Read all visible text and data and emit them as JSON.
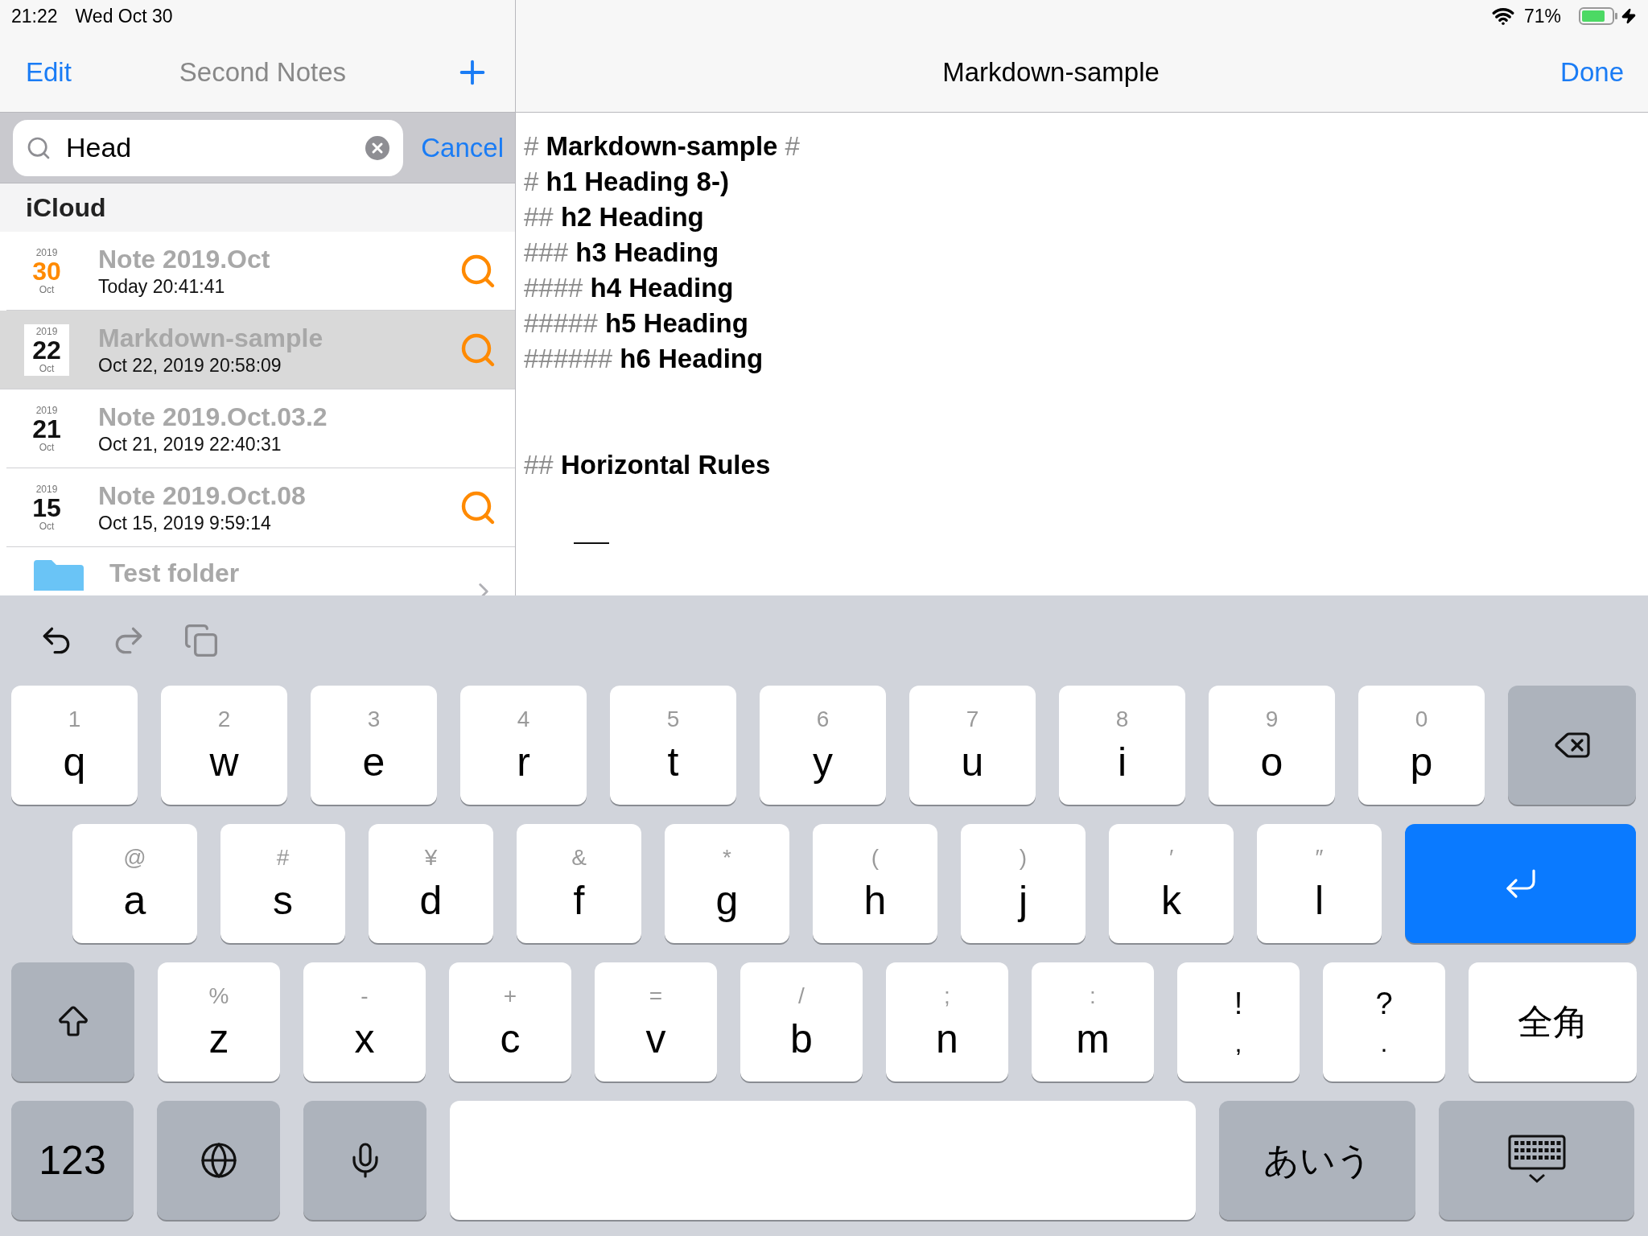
{
  "status_bar": {
    "time": "21:22",
    "date": "Wed Oct 30",
    "battery": "71%",
    "charging": true
  },
  "sidebar": {
    "edit": "Edit",
    "title": "Second Notes",
    "search": {
      "value": "Head",
      "cancel": "Cancel"
    },
    "section": "iCloud",
    "notes": [
      {
        "year": "2019",
        "day": "30",
        "month": "Oct",
        "title": "Note 2019.Oct",
        "subtitle": "Today 20:41:41",
        "today": true,
        "matched": true,
        "selected": false
      },
      {
        "year": "2019",
        "day": "22",
        "month": "Oct",
        "title": "Markdown-sample",
        "subtitle": "Oct 22, 2019 20:58:09",
        "today": false,
        "matched": true,
        "selected": true
      },
      {
        "year": "2019",
        "day": "21",
        "month": "Oct",
        "title": "Note 2019.Oct.03.2",
        "subtitle": "Oct 21, 2019 22:40:31",
        "today": false,
        "matched": false,
        "selected": false
      },
      {
        "year": "2019",
        "day": "15",
        "month": "Oct",
        "title": "Note 2019.Oct.08",
        "subtitle": "Oct 15, 2019 9:59:14",
        "today": false,
        "matched": true,
        "selected": false
      }
    ],
    "folder": {
      "title": "Test folder"
    }
  },
  "editor": {
    "title": "Markdown-sample",
    "done": "Done",
    "lines": [
      {
        "kind": "heading",
        "marks": "#",
        "text": "Markdown-sample",
        "trail": "#"
      },
      {
        "kind": "heading",
        "marks": "#",
        "text": "h1 Heading 8-)"
      },
      {
        "kind": "heading",
        "marks": "##",
        "text": "h2 Heading"
      },
      {
        "kind": "heading",
        "marks": "###",
        "text": "h3 Heading"
      },
      {
        "kind": "heading",
        "marks": "####",
        "text": "h4 Heading"
      },
      {
        "kind": "heading",
        "marks": "#####",
        "text": "h5 Heading"
      },
      {
        "kind": "heading",
        "marks": "######",
        "text": "h6 Heading"
      },
      {
        "kind": "blank"
      },
      {
        "kind": "blank"
      },
      {
        "kind": "heading",
        "marks": "##",
        "text": "Horizontal Rules"
      },
      {
        "kind": "blank"
      },
      {
        "kind": "rule"
      }
    ]
  },
  "keyboard": {
    "toolbar": [
      {
        "kind": "undo",
        "disabled": false
      },
      {
        "kind": "redo",
        "disabled": true
      },
      {
        "kind": "paste",
        "disabled": true
      }
    ],
    "rows": [
      {
        "keys": [
          {
            "kind": "letter",
            "hint": "1",
            "label": "q"
          },
          {
            "kind": "letter",
            "hint": "2",
            "label": "w"
          },
          {
            "kind": "letter",
            "hint": "3",
            "label": "e"
          },
          {
            "kind": "letter",
            "hint": "4",
            "label": "r"
          },
          {
            "kind": "letter",
            "hint": "5",
            "label": "t"
          },
          {
            "kind": "letter",
            "hint": "6",
            "label": "y"
          },
          {
            "kind": "letter",
            "hint": "7",
            "label": "u"
          },
          {
            "kind": "letter",
            "hint": "8",
            "label": "i"
          },
          {
            "kind": "letter",
            "hint": "9",
            "label": "o"
          },
          {
            "kind": "letter",
            "hint": "0",
            "label": "p"
          },
          {
            "kind": "delete"
          }
        ]
      },
      {
        "keys": [
          {
            "kind": "letter",
            "hint": "@",
            "label": "a"
          },
          {
            "kind": "letter",
            "hint": "#",
            "label": "s"
          },
          {
            "kind": "letter",
            "hint": "¥",
            "label": "d"
          },
          {
            "kind": "letter",
            "hint": "&",
            "label": "f"
          },
          {
            "kind": "letter",
            "hint": "*",
            "label": "g"
          },
          {
            "kind": "letter",
            "hint": "(",
            "label": "h"
          },
          {
            "kind": "letter",
            "hint": ")",
            "label": "j"
          },
          {
            "kind": "letter",
            "hint": "′",
            "label": "k"
          },
          {
            "kind": "letter",
            "hint": "″",
            "label": "l"
          },
          {
            "kind": "return"
          }
        ]
      },
      {
        "keys": [
          {
            "kind": "shift"
          },
          {
            "kind": "letter",
            "hint": "%",
            "label": "z"
          },
          {
            "kind": "letter",
            "hint": "-",
            "label": "x"
          },
          {
            "kind": "letter",
            "hint": "+",
            "label": "c"
          },
          {
            "kind": "letter",
            "hint": "=",
            "label": "v"
          },
          {
            "kind": "letter",
            "hint": "/",
            "label": "b"
          },
          {
            "kind": "letter",
            "hint": ";",
            "label": "n"
          },
          {
            "kind": "letter",
            "hint": ":",
            "label": "m"
          },
          {
            "kind": "punct",
            "hint": "!",
            "label": ","
          },
          {
            "kind": "punct",
            "hint": "?",
            "label": "."
          },
          {
            "kind": "wide",
            "label": "全角"
          }
        ]
      },
      {
        "keys": [
          {
            "kind": "numbers",
            "label": "123"
          },
          {
            "kind": "globe"
          },
          {
            "kind": "mic"
          },
          {
            "kind": "space"
          },
          {
            "kind": "kana",
            "label": "あいう"
          },
          {
            "kind": "dismiss"
          }
        ]
      }
    ]
  }
}
